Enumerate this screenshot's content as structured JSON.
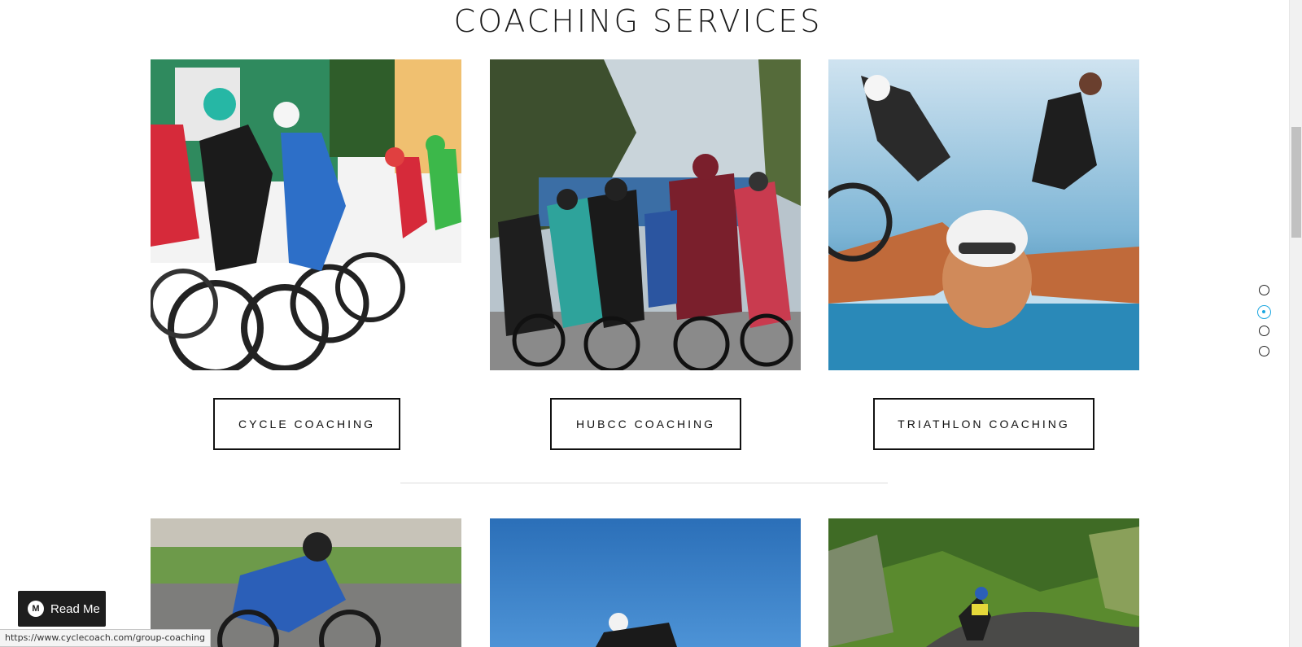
{
  "section": {
    "title": "COACHING SERVICES"
  },
  "services": [
    {
      "label": "CYCLE COACHING"
    },
    {
      "label": "HUBCC COACHING"
    },
    {
      "label": "TRIATHLON COACHING"
    }
  ],
  "dot_nav": {
    "count": 4,
    "active_index": 1,
    "active_color": "#1aa6e0"
  },
  "read_me": {
    "label": "Read Me",
    "icon": "medium-logo-icon"
  },
  "status_bar": {
    "url": "https://www.cyclecoach.com/group-coaching"
  }
}
